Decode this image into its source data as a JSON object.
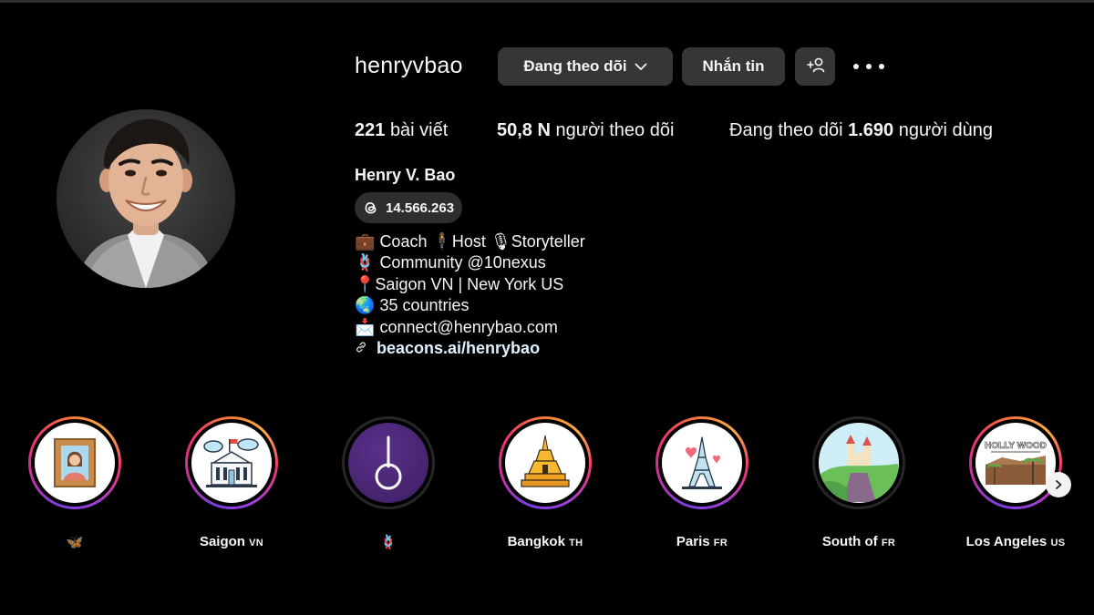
{
  "profile": {
    "username": "henryvbao",
    "buttons": {
      "following": "Đang theo dõi",
      "message": "Nhắn tin"
    },
    "stats": {
      "posts_count": "221",
      "posts_label": "bài viết",
      "followers_count": "50,8 N",
      "followers_label": "người theo dõi",
      "following_prefix": "Đang theo dõi",
      "following_count": "1.690",
      "following_suffix": "người dùng"
    },
    "full_name": "Henry V. Bao",
    "threads_count": "14.566.263",
    "bio": {
      "line1_emoji": "💼",
      "line1": "Coach 🕴Host 🎙Storyteller",
      "line2_emoji": "🪢",
      "line2": "Community @10nexus",
      "line3_emoji": "📍",
      "line3": "Saigon VN | New York US",
      "line4_emoji": "🌏",
      "line4": "35 countries",
      "line5_emoji": "📩",
      "line5": "connect@henrybao.com",
      "link": "beacons.ai/henrybao"
    }
  },
  "highlights": [
    {
      "name": "🦋",
      "country": ""
    },
    {
      "name": "Saigon",
      "country": "VN"
    },
    {
      "name": "🪢",
      "country": ""
    },
    {
      "name": "Bangkok",
      "country": "TH"
    },
    {
      "name": "Paris",
      "country": "FR"
    },
    {
      "name": "South of",
      "country": "FR"
    },
    {
      "name": "Los Angeles",
      "country": "US"
    }
  ],
  "highlight_cover_texts": {
    "hollywood": "HOLLY WOOD"
  },
  "colors": {
    "background": "#000000",
    "button": "#363636",
    "ring_gradient": [
      "#7b3fe4",
      "#f0346e",
      "#fcaf45"
    ]
  },
  "icons": [
    "chevron-down-icon",
    "add-user-icon",
    "more-icon",
    "threads-icon",
    "link-icon",
    "next-arrow-icon"
  ]
}
